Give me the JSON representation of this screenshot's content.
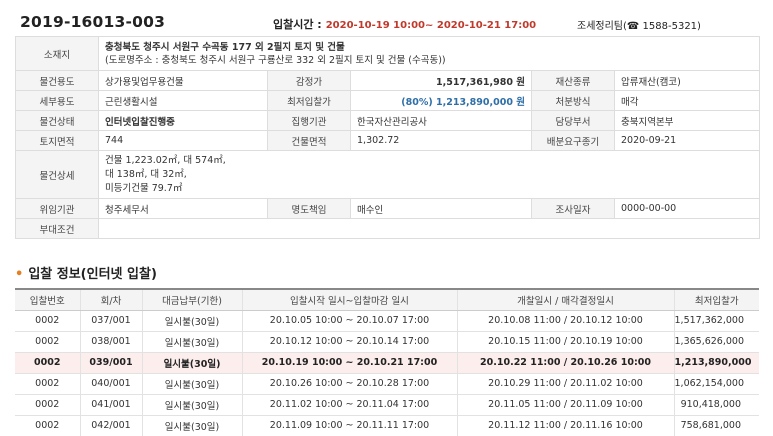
{
  "header": {
    "case_no": "2019-16013-003",
    "bid_time_label": "입찰시간 :",
    "bid_time_value": "2020-10-19 10:00~ 2020-10-21 17:00",
    "team": "조세정리팀(☎ 1588-5321)"
  },
  "info": {
    "location_label": "소재지",
    "location_main": "충청북도 청주시 서원구 수곡동 177 외 2필지 토지 및 건물",
    "location_road": "(도로명주소 : 충청북도 청주시 서원구 구룡산로 332 외 2필지 토지 및 건물 (수곡동))",
    "use_label": "물건용도",
    "use_value": "상가용및업무용건물",
    "appraisal_label": "감정가",
    "appraisal_value": "1,517,361,980 원",
    "asset_type_label": "재산종류",
    "asset_type_value": "압류재산(캠코)",
    "detail_use_label": "세부용도",
    "detail_use_value": "근린생활시설",
    "min_bid_label": "최저입찰가",
    "min_bid_value": "(80%) 1,213,890,000 원",
    "disposal_label": "처분방식",
    "disposal_value": "매각",
    "status_label": "물건상태",
    "status_value": "인터넷입찰진행중",
    "exec_agency_label": "집행기관",
    "exec_agency_value": "한국자산관리공사",
    "dept_label": "담당부서",
    "dept_value": "충북지역본부",
    "land_area_label": "토지면적",
    "land_area_value": "744",
    "building_area_label": "건물면적",
    "building_area_value": "1,302.72",
    "dist_date_label": "배분요구종기",
    "dist_date_value": "2020-09-21",
    "detail_label": "물건상세",
    "detail_line1": "건물 1,223.02㎡, 대 574㎡,",
    "detail_line2": "대 138㎡, 대 32㎡,",
    "detail_line3": "미등기건물 79.7㎡",
    "delegator_label": "위임기관",
    "delegator_value": "청주세무서",
    "eviction_label": "명도책임",
    "eviction_value": "매수인",
    "survey_label": "조사일자",
    "survey_value": "0000-00-00",
    "condition_label": "부대조건",
    "condition_value": ""
  },
  "bids": {
    "title": "입찰 정보(인터넷 입찰)",
    "headers": [
      "입찰번호",
      "회/차",
      "대금납부(기한)",
      "입찰시작 일시~입찰마감 일시",
      "개찰일시 / 매각결정일시",
      "최저입찰가"
    ],
    "rows": [
      [
        "0002",
        "037/001",
        "일시불(30일)",
        "20.10.05 10:00 ~ 20.10.07 17:00",
        "20.10.08 11:00 / 20.10.12 10:00",
        "1,517,362,000"
      ],
      [
        "0002",
        "038/001",
        "일시불(30일)",
        "20.10.12 10:00 ~ 20.10.14 17:00",
        "20.10.15 11:00 / 20.10.19 10:00",
        "1,365,626,000"
      ],
      [
        "0002",
        "039/001",
        "일시불(30일)",
        "20.10.19 10:00 ~ 20.10.21 17:00",
        "20.10.22 11:00 / 20.10.26 10:00",
        "1,213,890,000"
      ],
      [
        "0002",
        "040/001",
        "일시불(30일)",
        "20.10.26 10:00 ~ 20.10.28 17:00",
        "20.10.29 11:00 / 20.11.02 10:00",
        "1,062,154,000"
      ],
      [
        "0002",
        "041/001",
        "일시불(30일)",
        "20.11.02 10:00 ~ 20.11.04 17:00",
        "20.11.05 11:00 / 20.11.09 10:00",
        "910,418,000"
      ],
      [
        "0002",
        "042/001",
        "일시불(30일)",
        "20.11.09 10:00 ~ 20.11.11 17:00",
        "20.11.12 11:00 / 20.11.16 10:00",
        "758,681,000"
      ]
    ]
  }
}
